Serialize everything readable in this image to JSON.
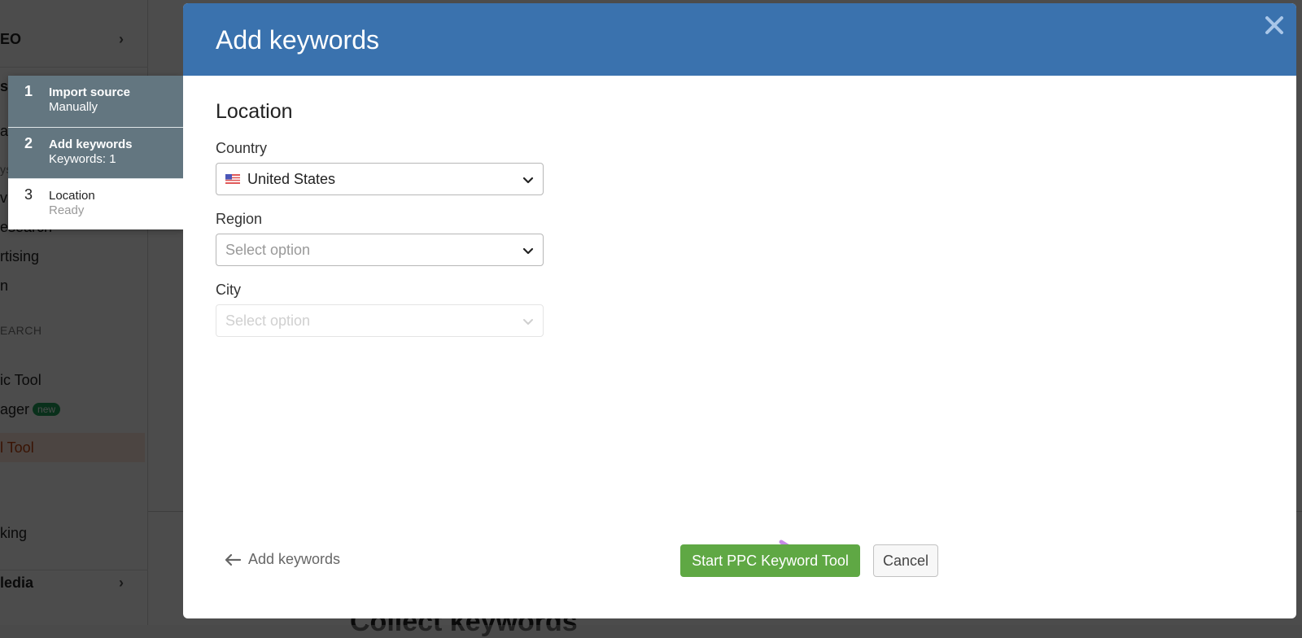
{
  "background": {
    "sidebar": [
      {
        "label": "EO",
        "bold": true,
        "chevron": true
      },
      {
        "label": "si"
      },
      {
        "label": "a"
      },
      {
        "label": "ys"
      },
      {
        "label": "vi"
      },
      {
        "label": "esearch"
      },
      {
        "label": "rtising"
      },
      {
        "label": "n"
      },
      {
        "label": "EARCH",
        "section": true
      },
      {
        "label": "ic Tool"
      },
      {
        "label": "ager",
        "badge": "new"
      },
      {
        "label": "l Tool",
        "active": true
      },
      {
        "label": "king"
      },
      {
        "label": "ledia",
        "bold": true,
        "chevron": true
      }
    ],
    "main_heading": "Collect keywords"
  },
  "steps": [
    {
      "number": "1",
      "title": "Import source",
      "subtitle": "Manually",
      "state": "done"
    },
    {
      "number": "2",
      "title": "Add keywords",
      "subtitle": "Keywords: 1",
      "state": "done"
    },
    {
      "number": "3",
      "title": "Location",
      "subtitle": "Ready",
      "state": "current"
    }
  ],
  "modal": {
    "title": "Add keywords",
    "close_icon": "close-icon",
    "section_title": "Location",
    "fields": {
      "country": {
        "label": "Country",
        "value": "United States",
        "flag": "us-flag-icon"
      },
      "region": {
        "label": "Region",
        "placeholder": "Select option"
      },
      "city": {
        "label": "City",
        "placeholder": "Select option",
        "disabled": true
      }
    },
    "footer": {
      "back_label": "Add keywords",
      "primary_label": "Start PPC Keyword Tool",
      "cancel_label": "Cancel"
    }
  },
  "colors": {
    "header_blue": "#3a72ae",
    "primary_green": "#5fa844",
    "step_done_bg": "#637680",
    "annotation_arrow": "#c58ae6"
  }
}
